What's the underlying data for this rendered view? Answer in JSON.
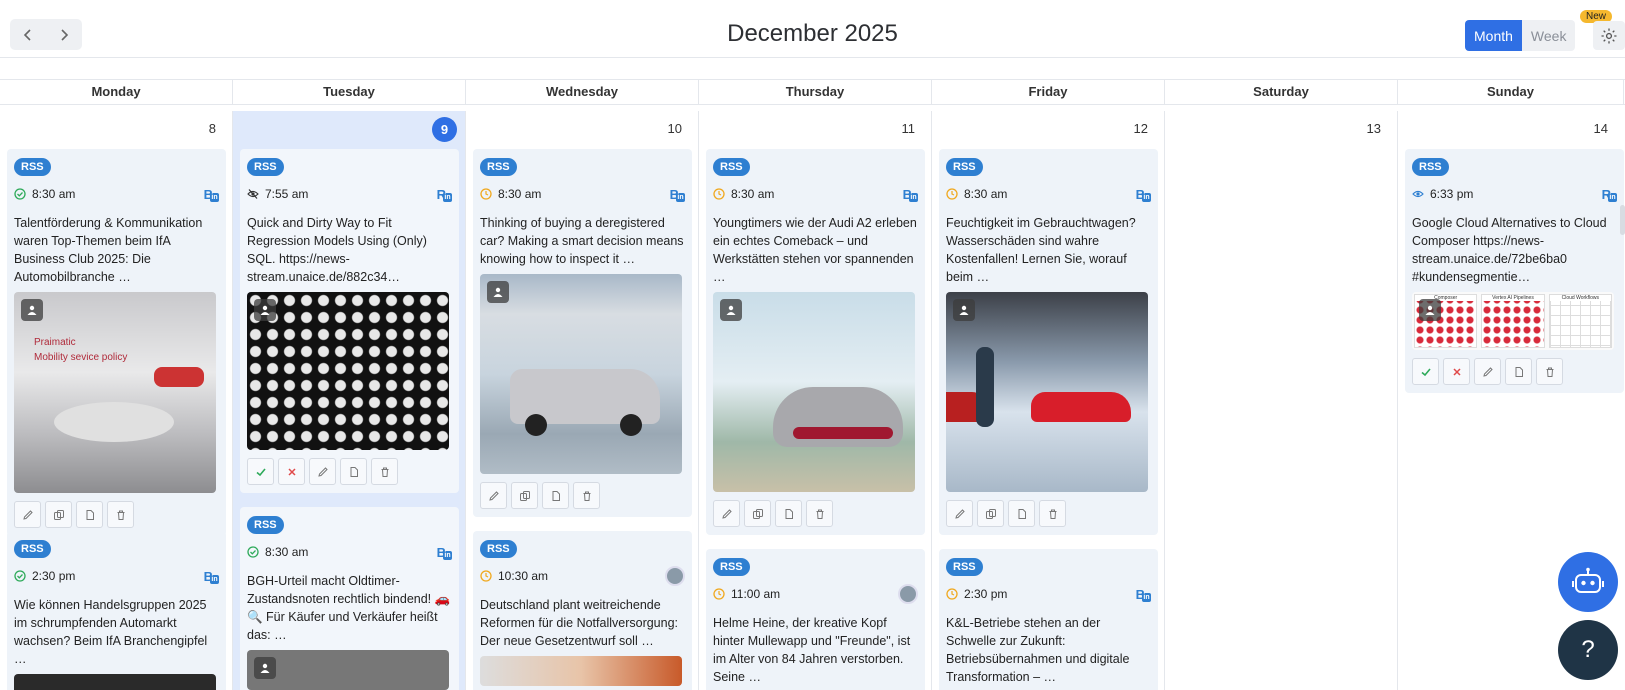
{
  "header": {
    "title": "December 2025",
    "month_label": "Month",
    "week_label": "Week",
    "new_badge": "New"
  },
  "days": [
    "Monday",
    "Tuesday",
    "Wednesday",
    "Thursday",
    "Friday",
    "Saturday",
    "Sunday"
  ],
  "dates": [
    "8",
    "9",
    "10",
    "11",
    "12",
    "13",
    "14"
  ],
  "rss_label": "RSS",
  "cards": {
    "mon1": {
      "time": "8:30 am",
      "text": "Talentförderung & Kommunikation waren Top-Themen beim IfA Business Club 2025: Die Automobilbranche …"
    },
    "mon2": {
      "time": "2:30 pm",
      "text": "Wie können Handelsgruppen 2025 im schrumpfenden Automarkt wachsen? Beim IfA Branchengipfel …"
    },
    "tue1": {
      "time": "7:55 am",
      "text": "Quick and Dirty Way to Fit Regression Models Using (Only) SQL. https://news-stream.unaice.de/882c34…"
    },
    "tue2": {
      "time": "8:30 am",
      "text": "BGH-Urteil macht Oldtimer-Zustandsnoten rechtlich bindend! 🚗 🔍 Für Käufer und Verkäufer heißt das: …"
    },
    "wed1": {
      "time": "8:30 am",
      "text": "Thinking of buying a deregistered car? Making a smart decision means knowing how to inspect it …"
    },
    "wed2": {
      "time": "10:30 am",
      "text": "Deutschland plant weitreichende Reformen für die Notfallversorgung: Der neue Gesetzentwurf soll …"
    },
    "thu1": {
      "time": "8:30 am",
      "text": "Youngtimers wie der Audi A2 erleben ein echtes Comeback – und Werkstätten stehen vor spannenden …"
    },
    "thu2": {
      "time": "11:00 am",
      "text": "Helme Heine, der kreative Kopf hinter Mullewapp und \"Freunde\", ist im Alter von 84 Jahren verstorben. Seine …"
    },
    "fri1": {
      "time": "8:30 am",
      "text": "Feuchtigkeit im Gebrauchtwagen? Wasserschäden sind wahre Kostenfallen! Lernen Sie, worauf beim …"
    },
    "fri2": {
      "time": "2:30 pm",
      "text": "K&L-Betriebe stehen an der Schwelle zur Zukunft: Betriebsübernahmen und digitale Transformation – …"
    },
    "sun1": {
      "time": "6:33 pm",
      "text": "Google Cloud Alternatives to Cloud Composer https://news-stream.unaice.de/72be6ba0 #kundensegmentie…"
    }
  },
  "image_texts": {
    "mon1_l1": "Praimatic",
    "mon1_l2": "Mobility sevice policy",
    "sun_h1": "Composer",
    "sun_h2": "Vertex AI Pipelines",
    "sun_h3": "Cloud Workflows"
  },
  "colors": {
    "accent": "#2f6fe4",
    "rss": "#2e7fd1",
    "today_bg": "#dfe9fb",
    "card_bg": "#eef3f9"
  },
  "icons": [
    "chevron-left-icon",
    "chevron-right-icon",
    "gear-icon",
    "check-circle-icon",
    "clock-icon",
    "eye-off-icon",
    "eye-icon",
    "buffer-icon",
    "linkedin-icon",
    "image-icon",
    "edit-icon",
    "copy-icon",
    "file-icon",
    "trash-icon",
    "robot-icon"
  ],
  "help_label": "?"
}
